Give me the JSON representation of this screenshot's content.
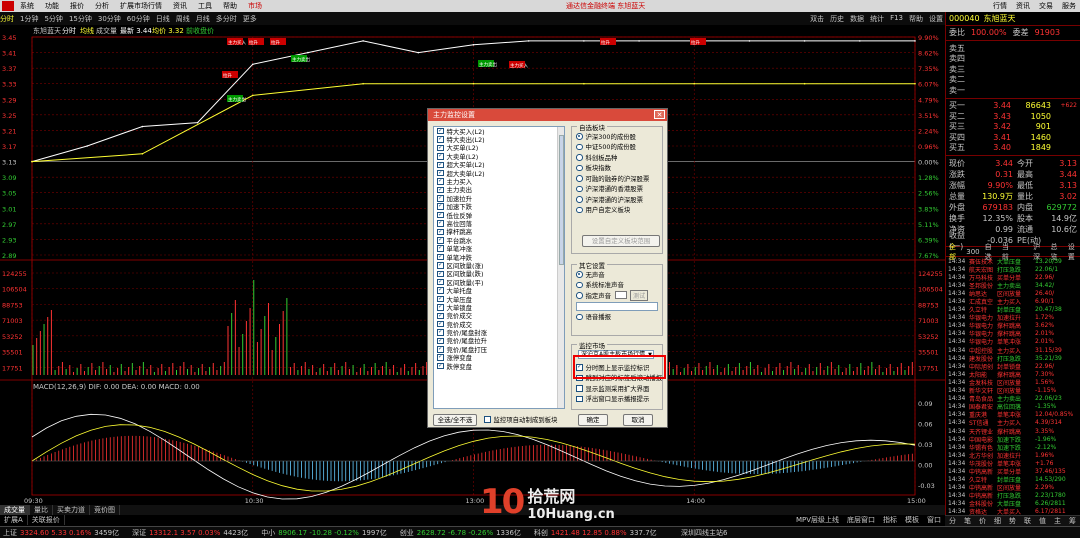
{
  "menu": {
    "items": [
      "系统",
      "功能",
      "报价",
      "分析",
      "扩展市场行情",
      "资讯",
      "工具",
      "帮助",
      "市场"
    ],
    "title": "通达信金融终端 东旭蓝天",
    "right": [
      "行情",
      "资讯",
      "交易",
      "服务"
    ]
  },
  "timeframes": [
    "分时",
    "1分钟",
    "5分钟",
    "15分钟",
    "30分钟",
    "60分钟",
    "日线",
    "周线",
    "月线",
    "多分时",
    "更多"
  ],
  "toolbar_right": [
    "双击",
    "历史",
    "数据",
    "统计",
    "F13",
    "帮助",
    "设置"
  ],
  "chart": {
    "header": {
      "name": "东旭蓝天",
      "t1": "分时",
      "t2": "均线",
      "t3": "成交量",
      "t4": "最新 3.44",
      "t5": "均价 3.32",
      "t6": "前收盘价"
    },
    "price_labels": [
      "3.45",
      "3.41",
      "3.37",
      "3.33",
      "3.29",
      "3.25",
      "3.21",
      "3.17",
      "3.13",
      "3.09",
      "3.05",
      "3.01",
      "2.97",
      "2.93",
      "2.89"
    ],
    "pct_labels": [
      "9.90%",
      "8.62%",
      "7.35%",
      "6.07%",
      "4.79%",
      "3.51%",
      "2.24%",
      "0.96%",
      "0.00%",
      "1.28%",
      "2.56%",
      "3.83%",
      "5.11%",
      "6.39%",
      "7.67%"
    ],
    "vol_labels": [
      "124255",
      "106504",
      "88753",
      "71003",
      "53252",
      "35501",
      "17751"
    ],
    "macd_header": "MACD(12,26,9) DIF: 0.00 DEA: 0.00 MACD: 0.00",
    "macd_labels": [
      "0.09",
      "0.06",
      "0.03",
      "0.00",
      "-0.03"
    ],
    "time_labels": [
      "09:30",
      "10:30",
      "13:00",
      "14:00",
      "15:00"
    ],
    "markers": [
      "主力买入",
      "主力卖出",
      "拉升",
      "打压"
    ]
  },
  "chart_data": {
    "type": "line",
    "title": "东旭蓝天",
    "xlabel": "",
    "ylabel": "",
    "series": [
      {
        "name": "最新",
        "x": [
          "09:30",
          "09:45",
          "10:00",
          "10:15",
          "10:30",
          "10:45",
          "11:00",
          "11:15",
          "11:30",
          "13:15",
          "13:30",
          "13:45",
          "14:00",
          "14:15",
          "14:30",
          "14:45",
          "15:00"
        ],
        "values": [
          3.13,
          3.17,
          3.22,
          3.23,
          3.38,
          3.41,
          3.44,
          3.41,
          3.43,
          3.44,
          3.44,
          3.44,
          3.44,
          3.44,
          3.44,
          3.44,
          3.44
        ]
      },
      {
        "name": "均价",
        "x": [
          "09:30",
          "10:00",
          "10:30",
          "11:00",
          "11:30",
          "13:30",
          "14:00",
          "14:30",
          "15:00"
        ],
        "values": [
          3.13,
          3.15,
          3.3,
          3.33,
          3.33,
          3.33,
          3.33,
          3.33,
          3.33
        ]
      }
    ],
    "ylim": [
      2.89,
      3.45
    ]
  },
  "dialog": {
    "title": "主力监控设置",
    "checks": [
      "特大买入(L2)",
      "特大卖出(L2)",
      "大买单(L2)",
      "大卖单(L2)",
      "超大买单(L2)",
      "超大卖单(L2)",
      "主力买入",
      "主力卖出",
      "加速拉升",
      "加速下跌",
      "低位反弹",
      "高位回落",
      "撑杆跳高",
      "平台跳水",
      "单笔冲涨",
      "单笔冲跌",
      "区间放量(涨)",
      "区间放量(跌)",
      "区间放量(平)",
      "大单托盘",
      "大单压盘",
      "大单锁盘",
      "竞价成交",
      "竞价成交",
      "竞价/尾盘封涨",
      "竞价/尾盘拉升",
      "竞价/尾盘打压",
      "涨停变盘",
      "跌停变盘"
    ],
    "self_group": "自选板块",
    "self_opts": [
      "沪深300的成份股",
      "中证500的成份股",
      "科创板品种",
      "板块指数",
      "可融的融券的沪深股票",
      "沪深港通的香港股票",
      "沪深港通的沪深股票",
      "用户自定义板块"
    ],
    "set_btn": "设置自定义板块范围",
    "other_group": "其它设置",
    "other_opts": [
      "无声音",
      "系统标准声音",
      "指定声音",
      "语音播报"
    ],
    "test_btn": "测试",
    "monitor_group": "监控市场",
    "market_select": "深沪京A股主板市场行情",
    "opts2": [
      "分时图上显示监控标识",
      "跳到对应的标签后滚动播报",
      "显示监测采用扩大界面",
      "浮出窗口显示播报提示"
    ],
    "select_all": "全选/全不选",
    "auto_self": "监控项自动制成到板块",
    "ok": "确定",
    "cancel": "取消"
  },
  "quote": {
    "code": "000040",
    "name": "东旭蓝天",
    "ratio_lbl": "委比",
    "ratio_val": "100.00%",
    "diff_lbl": "委差",
    "diff_val": "91903",
    "sells": [
      {
        "lbl": "卖五",
        "px": "",
        "vol": "",
        "chg": ""
      },
      {
        "lbl": "卖四",
        "px": "",
        "vol": "",
        "chg": ""
      },
      {
        "lbl": "卖三",
        "px": "",
        "vol": "",
        "chg": ""
      },
      {
        "lbl": "卖二",
        "px": "",
        "vol": "",
        "chg": ""
      },
      {
        "lbl": "卖一",
        "px": "",
        "vol": "",
        "chg": ""
      }
    ],
    "buys": [
      {
        "lbl": "买一",
        "px": "3.44",
        "vol": "86643",
        "chg": "+622"
      },
      {
        "lbl": "买二",
        "px": "3.43",
        "vol": "1050",
        "chg": ""
      },
      {
        "lbl": "买三",
        "px": "3.42",
        "vol": "901",
        "chg": ""
      },
      {
        "lbl": "买四",
        "px": "3.41",
        "vol": "1460",
        "chg": ""
      },
      {
        "lbl": "买五",
        "px": "3.40",
        "vol": "1849",
        "chg": ""
      }
    ],
    "stats": [
      {
        "k": "现价",
        "v": "3.44",
        "k2": "今开",
        "v2": "3.13",
        "c1": "#f33",
        "c2": "#f33"
      },
      {
        "k": "涨跌",
        "v": "0.31",
        "k2": "最高",
        "v2": "3.44",
        "c1": "#f33",
        "c2": "#f33"
      },
      {
        "k": "涨幅",
        "v": "9.90%",
        "k2": "最低",
        "v2": "3.13",
        "c1": "#f33",
        "c2": "#f33"
      },
      {
        "k": "总量",
        "v": "130.9万",
        "k2": "量比",
        "v2": "3.02",
        "c1": "#ff3",
        "c2": "#f33"
      },
      {
        "k": "外盘",
        "v": "679183",
        "k2": "内盘",
        "v2": "629772",
        "c1": "#f33",
        "c2": "#3c3"
      },
      {
        "k": "换手",
        "v": "12.35%",
        "k2": "股本",
        "v2": "14.9亿",
        "c1": "#c8c8c8",
        "c2": "#c8c8c8"
      },
      {
        "k": "净资",
        "v": "0.99",
        "k2": "流通",
        "v2": "10.6亿",
        "c1": "#c8c8c8",
        "c2": "#c8c8c8"
      },
      {
        "k": "收益(一)",
        "v": "-0.036",
        "k2": "PE(动)",
        "v2": "",
        "c1": "#c8c8c8",
        "c2": "#c8c8c8"
      }
    ],
    "tabs": [
      "全部",
      "300",
      "自选",
      "当前",
      "沪深",
      "总览",
      "设置"
    ]
  },
  "ticker": [
    {
      "tm": "14:34",
      "nm": "赛伍技术",
      "tp": "大单压盘",
      "pc": "13.20/39"
    },
    {
      "tm": "14:34",
      "nm": "航天宏图",
      "tp": "打压急跌",
      "pc": "22.06/1"
    },
    {
      "tm": "14:34",
      "nm": "万马科技",
      "tp": "买单分单",
      "pc": "22.96/"
    },
    {
      "tm": "14:34",
      "nm": "圣邦股份",
      "tp": "主力卖出",
      "pc": "34.42/"
    },
    {
      "tm": "14:34",
      "nm": "纳思达",
      "tp": "区间放量",
      "pc": "26.40/"
    },
    {
      "tm": "14:34",
      "nm": "汇成真空",
      "tp": "主力买入",
      "pc": "6.90/1"
    },
    {
      "tm": "14:34",
      "nm": "久立特",
      "tp": "封单压盘",
      "pc": "20.47/38"
    },
    {
      "tm": "14:34",
      "nm": "华银电力",
      "tp": "加速拉升",
      "pc": "1.72%"
    },
    {
      "tm": "14:34",
      "nm": "华银电力",
      "tp": "撑杆跳高",
      "pc": "3.62%"
    },
    {
      "tm": "14:34",
      "nm": "华银电力",
      "tp": "撑杆跳高",
      "pc": "2.01%"
    },
    {
      "tm": "14:34",
      "nm": "华银电力",
      "tp": "单笔冲涨",
      "pc": "2.01%"
    },
    {
      "tm": "14:34",
      "nm": "中超控股",
      "tp": "主力买入",
      "pc": "31.15/39"
    },
    {
      "tm": "14:34",
      "nm": "建发股份",
      "tp": "打压急跌",
      "pc": "35.21/39"
    },
    {
      "tm": "14:34",
      "nm": "中际旭创",
      "tp": "封单锁盘",
      "pc": "22.96/"
    },
    {
      "tm": "14:34",
      "nm": "太阳能",
      "tp": "撑杆跳高",
      "pc": "7.30%"
    },
    {
      "tm": "14:34",
      "nm": "金发科技",
      "tp": "区间放量",
      "pc": "1.56%"
    },
    {
      "tm": "14:34",
      "nm": "新华文轩",
      "tp": "区间放量",
      "pc": "-1.15%"
    },
    {
      "tm": "14:34",
      "nm": "青岛食品",
      "tp": "主力卖出",
      "pc": "22.06/23"
    },
    {
      "tm": "14:34",
      "nm": "国泰君安",
      "tp": "高位回落",
      "pc": "-1.35%"
    },
    {
      "tm": "14:34",
      "nm": "重庆港",
      "tp": "单笔冲涨",
      "pc": "12.04/0.85%"
    },
    {
      "tm": "14:34",
      "nm": "ST信通",
      "tp": "主力买入",
      "pc": "4.39/314"
    },
    {
      "tm": "14:34",
      "nm": "天齐锂业",
      "tp": "撑杆跳高",
      "pc": "3.35%"
    },
    {
      "tm": "14:34",
      "nm": "中国电影",
      "tp": "加速下跌",
      "pc": "-1.96%"
    },
    {
      "tm": "14:34",
      "nm": "华锡有色",
      "tp": "加速下跌",
      "pc": "-2.12%"
    },
    {
      "tm": "14:34",
      "nm": "北方华创",
      "tp": "加速拉升",
      "pc": "1.96%"
    },
    {
      "tm": "14:34",
      "nm": "华茂股份",
      "tp": "单笔冲涨",
      "pc": "+1.76"
    },
    {
      "tm": "14:34",
      "nm": "中钨高新",
      "tp": "买单分单",
      "pc": "37.46/135"
    },
    {
      "tm": "14:34",
      "nm": "久立特",
      "tp": "封单压盘",
      "pc": "14.53/290"
    },
    {
      "tm": "14:34",
      "nm": "中钨高新",
      "tp": "区间放量",
      "pc": "2.29%"
    },
    {
      "tm": "14:34",
      "nm": "中钨高新",
      "tp": "打压急跌",
      "pc": "2.23/1780"
    },
    {
      "tm": "14:34",
      "nm": "金科股份",
      "tp": "大单压盘",
      "pc": "6.26/2811"
    },
    {
      "tm": "14:34",
      "nm": "资格达",
      "tp": "大单买入",
      "pc": "6.17/2811"
    },
    {
      "tm": "14:34",
      "nm": "资格达",
      "tp": "主力卖出",
      "pc": "8.17/2811"
    }
  ],
  "bottom_tabs": [
    "成交量",
    "量比",
    "买卖力道",
    "竞价图"
  ],
  "bottom_tabs2": [
    "扩展A",
    "关联报价"
  ],
  "bottom_right": [
    "指标",
    "模板",
    "窗口"
  ],
  "mpv": [
    "MPV层级上线",
    "底层窗口"
  ],
  "status": [
    {
      "n": "上证",
      "p": "3324.60",
      "c": "5.33",
      "pc": "0.16%",
      "a": "3459亿",
      "up": true
    },
    {
      "n": "深证",
      "p": "13312.1",
      "c": "3.57",
      "pc": "0.03%",
      "a": "4423亿",
      "up": true
    },
    {
      "n": "中小",
      "p": "8906.17",
      "c": "-10.28",
      "pc": "-0.12%",
      "a": "1997亿",
      "up": false
    },
    {
      "n": "创业",
      "p": "2628.72",
      "c": "-6.78",
      "pc": "-0.26%",
      "a": "1336亿",
      "up": false
    },
    {
      "n": "科创",
      "p": "1421.48",
      "c": "12.85",
      "pc": "0.88%",
      "a": "337.7亿",
      "up": true
    }
  ],
  "status_brand": "深圳四线主站6",
  "rp_bottom": [
    "分",
    "笔",
    "价",
    "细",
    "势",
    "联",
    "值",
    "主",
    "筹"
  ],
  "watermark": {
    "a": "10",
    "b": "拾荒网",
    "c": "10Huang.cn"
  },
  "colors": {
    "up": "#ff3333",
    "down": "#33cc33",
    "accent": "#ffff33",
    "grid": "#700000"
  }
}
